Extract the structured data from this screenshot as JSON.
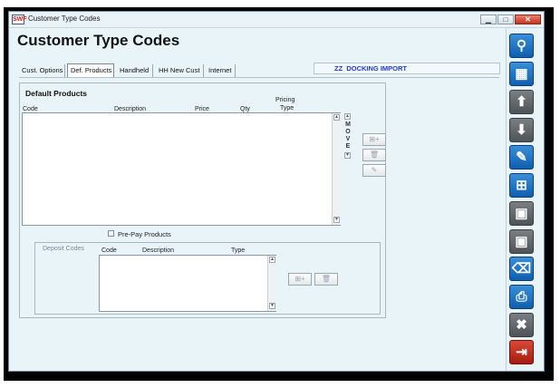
{
  "window": {
    "title": "Customer Type Codes",
    "app_icon_text": "SWF"
  },
  "page_title": "Customer Type Codes",
  "tabs": [
    {
      "label": "Cust. Options",
      "active": false
    },
    {
      "label": "Def. Products",
      "active": true
    },
    {
      "label": "Handheld",
      "active": false
    },
    {
      "label": "HH New Cust",
      "active": false
    },
    {
      "label": "Internet",
      "active": false
    }
  ],
  "code_bar": {
    "code": "ZZ",
    "name": "DOCKING IMPORT"
  },
  "default_products": {
    "title": "Default Products",
    "columns": {
      "code": "Code",
      "description": "Description",
      "price": "Price",
      "qty": "Qty",
      "pricing_type_1": "Pricing",
      "pricing_type_2": "Type"
    },
    "move_letters": [
      "M",
      "O",
      "V",
      "E"
    ]
  },
  "prepay": {
    "label": "Pre-Pay Products",
    "checked": false
  },
  "deposit_codes": {
    "title": "Deposit Codes",
    "columns": {
      "code": "Code",
      "description": "Description",
      "type": "Type"
    }
  },
  "colors": {
    "accent_blue": "#0e5fae",
    "code_text": "#1e3ccf",
    "background": "#e9f4f8"
  },
  "sidebar_icons": [
    {
      "name": "search-icon",
      "glyph": "🔍",
      "style": "blue"
    },
    {
      "name": "grid-icon",
      "glyph": "▦",
      "style": "blue"
    },
    {
      "name": "arrow-up-icon",
      "glyph": "⬆",
      "style": "gray"
    },
    {
      "name": "arrow-down-icon",
      "glyph": "⬇",
      "style": "gray"
    },
    {
      "name": "pencil-icon",
      "glyph": "✎",
      "style": "blue"
    },
    {
      "name": "add-document-icon",
      "glyph": "⊞",
      "style": "blue"
    },
    {
      "name": "save-add-icon",
      "glyph": "▣",
      "style": "gray"
    },
    {
      "name": "save-icon",
      "glyph": "▣",
      "style": "gray"
    },
    {
      "name": "trash-icon",
      "glyph": "🗑",
      "style": "blue"
    },
    {
      "name": "print-icon",
      "glyph": "⎙",
      "style": "blue"
    },
    {
      "name": "close-icon",
      "glyph": "✖",
      "style": "gray"
    },
    {
      "name": "exit-icon",
      "glyph": "⇥",
      "style": "red"
    }
  ]
}
